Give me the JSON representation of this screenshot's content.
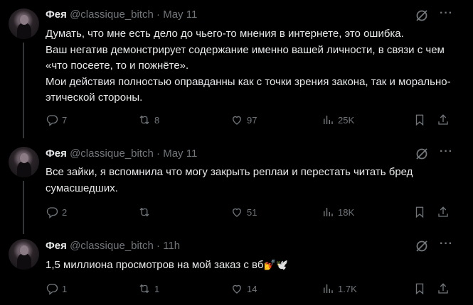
{
  "tweets": [
    {
      "name": "Фея",
      "handle": "@classique_bitch",
      "separator": "·",
      "date": "May 11",
      "lines": [
        "Думать, что мне есть дело до чьего-то мнения в интернете, это ошибка.",
        "Ваш негатив демонстрирует содержание именно вашей личности, в связи с чем «что посеете, то и пожнёте».",
        "Мои действия полностью оправданны как с точки зрения закона, так и морально-этической стороны."
      ],
      "replies": "7",
      "reposts": "8",
      "likes": "97",
      "views": "25K"
    },
    {
      "name": "Фея",
      "handle": "@classique_bitch",
      "separator": "·",
      "date": "May 11",
      "lines": [
        "Все зайки, я вспомнила что могу закрыть реплаи и перестать читать бред сумасшедших."
      ],
      "replies": "2",
      "reposts": "",
      "likes": "51",
      "views": "18K"
    },
    {
      "name": "Фея",
      "handle": "@classique_bitch",
      "separator": "·",
      "date": "11h",
      "lines": [
        "1,5 миллиона просмотров на мой заказ с вб"
      ],
      "emoji": "💅🕊️",
      "replies": "1",
      "reposts": "1",
      "likes": "14",
      "views": "1.7K"
    }
  ],
  "icons": {
    "reply": "reply-icon",
    "repost": "repost-icon",
    "like": "like-icon",
    "views": "views-icon",
    "share": "share-icon",
    "grok": "grok-icon",
    "more": "more-icon"
  },
  "colors": {
    "background": "#000000",
    "text": "#e7e9ea",
    "muted": "#71767b",
    "thread_line": "#333639"
  }
}
